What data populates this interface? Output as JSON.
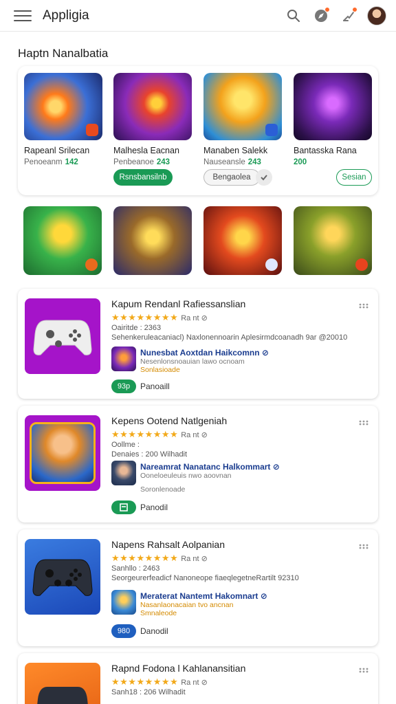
{
  "header": {
    "app_title": "Appligia",
    "icons": [
      "menu-icon",
      "search-icon",
      "compass-icon",
      "notification-icon",
      "user-avatar"
    ]
  },
  "section": {
    "title": "Haptn Nanalbatia"
  },
  "featured": [
    {
      "name": "Rapeanl Srilecan",
      "sub_label": "Penoeanm",
      "sub_value": "142",
      "button": ""
    },
    {
      "name": "Malhesla Eacnan",
      "sub_label": "Penbeanoe",
      "sub_value": "243",
      "button": "Rsnsbansilnb"
    },
    {
      "name": "Manaben Salekk",
      "sub_label": "Nauseansle",
      "sub_value": "243",
      "button": "Bengaolea"
    },
    {
      "name": "Bantasska Rana",
      "sub_label": "",
      "sub_value": "200",
      "button": "Sesian"
    }
  ],
  "cards": [
    {
      "title": "Kapum Rendanl Rafiessanslian",
      "rating": "★★★★★★★★",
      "rating_text": "Ra nt ⊘",
      "meta1": "Oairitde : 2363",
      "meta2": "Sehenkeruleacaniacl) Naxlonennoarin Aplesirmdcoanadh 9ar @20010",
      "dev_name": "Nunesbat Aoxtdan Haikcomnn ⊘",
      "dev_sub": "Nesenlonsnoauian lawo ocnoam",
      "dev_sub2": "Sonlasioade",
      "price": "93p",
      "price_label": "Panoaill",
      "price_color": "#1a9a55"
    },
    {
      "title": "Kepens Ootend Natlgeniah",
      "rating": "★★★★★★★★",
      "rating_text": "Ra nt ⊘",
      "meta1": "Oollme :",
      "meta2": "Denaies : 200 Wilhadit",
      "dev_name": "Nareamrat Nanatanc Halkommart ⊘",
      "dev_sub": "Ooneloeuleuis nwo aoovnan",
      "dev_sub2": "Soronlenoade",
      "price": "",
      "price_label": "Panodil",
      "price_color": "#1a9a55"
    },
    {
      "title": "Napens Rahsalt Aolpanian",
      "rating": "★★★★★★★★",
      "rating_text": "Ra nt ⊘",
      "meta1": "Sanhllo : 2463",
      "meta2": "Seorgeurerfeadicf Nanoneope fiaeqlegetneRartilt 92310",
      "dev_name": "Meraterat Nantemt Hakomnart ⊘",
      "dev_sub": "Nasanlaonacaian tvo ancnan",
      "dev_sub2": "Smnaleode",
      "price": "980",
      "price_label": "Danodil",
      "price_color": "#1f5fbf"
    },
    {
      "title": "Rapnd Fodona l Kahlanansitian",
      "rating": "★★★★★★★★",
      "rating_text": "Ra nt ⊘",
      "meta1": "Sanh18 : 206 Wilhadit",
      "meta2": "",
      "dev_name": "",
      "dev_sub": "",
      "dev_sub2": "",
      "price": "",
      "price_label": "",
      "price_color": "#1a9a55"
    }
  ]
}
